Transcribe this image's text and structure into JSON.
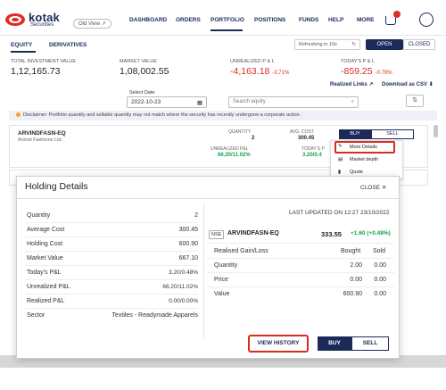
{
  "header": {
    "logo_text": "kotak",
    "logo_sub": "Securities",
    "old_view": "Old View",
    "nav": [
      "DASHBOARD",
      "ORDERS",
      "PORTFOLIO",
      "POSITIONS",
      "FUNDS",
      "HELP",
      "MORE"
    ],
    "active_nav": "PORTFOLIO"
  },
  "tabs": {
    "equity": "EQUITY",
    "derivatives": "DERIVATIVES"
  },
  "refresh": "Refreshing in 10s",
  "market": {
    "open": "OPEN",
    "closed": "CLOSED"
  },
  "summary": {
    "total_investment_label": "TOTAL INVESTMENT VALUE",
    "total_investment": "1,12,165.73",
    "market_value_label": "MARKET VALUE",
    "market_value": "1,08,002.55",
    "unrealized_label": "UNREALIZED P & L",
    "unrealized": "-4,163.18",
    "unrealized_pct": "-3.71%",
    "todays_label": "TODAY'S P & L",
    "todays": "-859.25",
    "todays_pct": "-0.79%"
  },
  "links": {
    "realized": "Realized Links",
    "download": "Download as CSV"
  },
  "filters": {
    "select_date_label": "Select Date",
    "date_value": "2022-10-23",
    "search_placeholder": "Search equity"
  },
  "disclaimer": "Disclaimer: Portfolio quantity and sellable quantity may not match where the security has recently undergone a corporate action.",
  "holding": {
    "symbol": "ARVINDFASN-EQ",
    "company": "Arvind Fashions Ltd.",
    "quantity_label": "QUANTITY",
    "quantity": "2",
    "avg_cost_label": "AVG. COST",
    "avg_cost": "300.45",
    "unrealized_label": "UNREALIZED P&L",
    "unrealized": "66.20/11.02%",
    "todays_label": "TODAY'S P",
    "todays": "3.20/0.4",
    "buy": "BUY",
    "sell": "SELL"
  },
  "context_menu": [
    "More Details",
    "Market depth",
    "Quote"
  ],
  "modal": {
    "title": "Holding Details",
    "close": "CLOSE",
    "left_rows": [
      {
        "label": "Quantity",
        "value": "2"
      },
      {
        "label": "Average Cost",
        "value": "300.45"
      },
      {
        "label": "Holding Cost",
        "value": "600.90"
      },
      {
        "label": "Market Value",
        "value": "667.10"
      },
      {
        "label": "Today's P&L",
        "value": "3.20/0.48%"
      },
      {
        "label": "Unrealized P&L",
        "value": "66.20/11.02%"
      },
      {
        "label": "Realized P&L",
        "value": "0.00/0.00%"
      },
      {
        "label": "Sector",
        "value": "Textiles - Readymade Apparels"
      }
    ],
    "last_updated": "LAST UPDATED ON 12:27 23/10/2022",
    "exchange": "NSE",
    "symbol": "ARVINDFASN-EQ",
    "ltp": "333.55",
    "change": "+1.60 (+0.48%)",
    "table_headers": [
      "Realised Gain/Loss",
      "Bought",
      "Sold"
    ],
    "table_rows": [
      {
        "label": "Quantity",
        "bought": "2.00",
        "sold": "0.00"
      },
      {
        "label": "Price",
        "bought": "0.00",
        "sold": "0.00"
      },
      {
        "label": "Value",
        "bought": "600.90",
        "sold": "0.00"
      }
    ],
    "view_history": "VIEW HISTORY",
    "buy": "BUY",
    "sell": "SELL"
  }
}
